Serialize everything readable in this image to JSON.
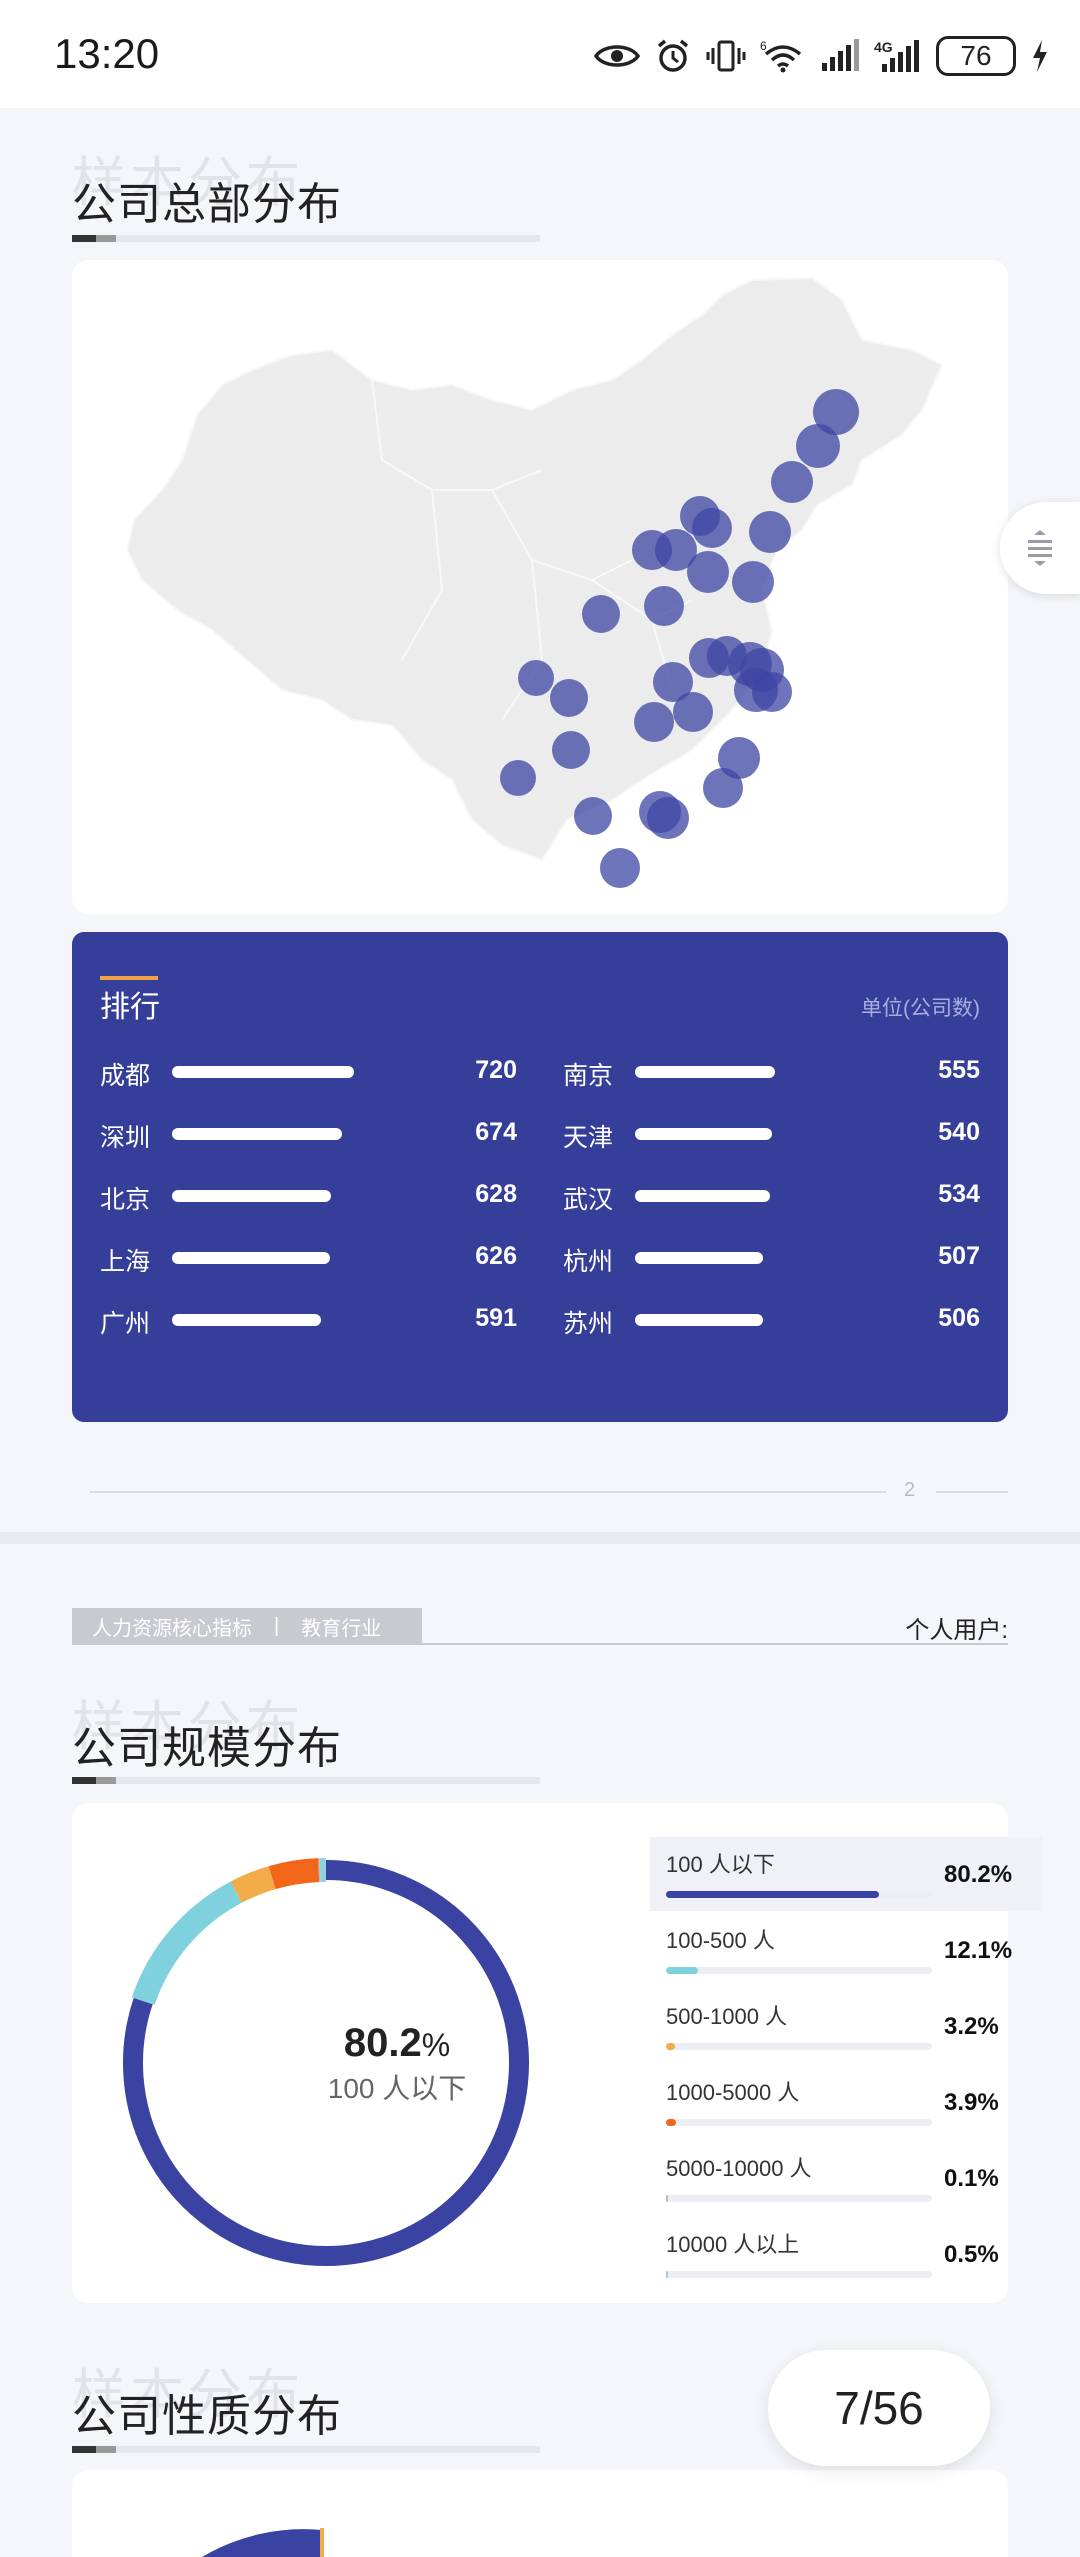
{
  "status_bar": {
    "time": "13:20",
    "battery": "76",
    "network": "4G",
    "wifi_label": "6",
    "icons": [
      "eye-icon",
      "alarm-icon",
      "vibrate-icon",
      "wifi-icon",
      "signal-icon",
      "signal-4g-icon",
      "battery-icon",
      "charging-icon"
    ]
  },
  "section1": {
    "watermark": "样本分布",
    "title": "公司总部分布",
    "map": {
      "marker_color": "#3d45a3"
    },
    "ranking": {
      "title": "排行",
      "unit": "单位(公司数)",
      "left": [
        {
          "city": "成都",
          "value": 720
        },
        {
          "city": "深圳",
          "value": 674
        },
        {
          "city": "北京",
          "value": 628
        },
        {
          "city": "上海",
          "value": 626
        },
        {
          "city": "广州",
          "value": 591
        }
      ],
      "right": [
        {
          "city": "南京",
          "value": 555
        },
        {
          "city": "天津",
          "value": 540
        },
        {
          "city": "武汉",
          "value": 534
        },
        {
          "city": "杭州",
          "value": 507
        },
        {
          "city": "苏州",
          "value": 506
        }
      ]
    },
    "page_number": "2"
  },
  "section2": {
    "tag_left": "人力资源核心指标",
    "tag_separator": "|",
    "tag_right": "教育行业",
    "user_label": "个人用户:",
    "watermark": "样本分布",
    "title": "公司规模分布",
    "chart_data": {
      "type": "pie",
      "categories": [
        "100 人以下",
        "100-500 人",
        "500-1000 人",
        "1000-5000 人",
        "5000-10000 人",
        "10000 人以上"
      ],
      "values": [
        80.2,
        12.1,
        3.2,
        3.9,
        0.1,
        0.5
      ],
      "labels": [
        "80.2%",
        "12.1%",
        "3.2%",
        "3.9%",
        "0.1%",
        "0.5%"
      ],
      "colors": [
        "#3a43a2",
        "#7fd1dd",
        "#f2ad4a",
        "#f3661a",
        "#b9bbc4",
        "#8fd3df"
      ],
      "center_value": "80.2",
      "center_unit": "%",
      "center_label": "100 人以下"
    }
  },
  "section3": {
    "watermark": "样本分布",
    "title": "公司性质分布"
  },
  "pager": {
    "label": "7/56"
  }
}
